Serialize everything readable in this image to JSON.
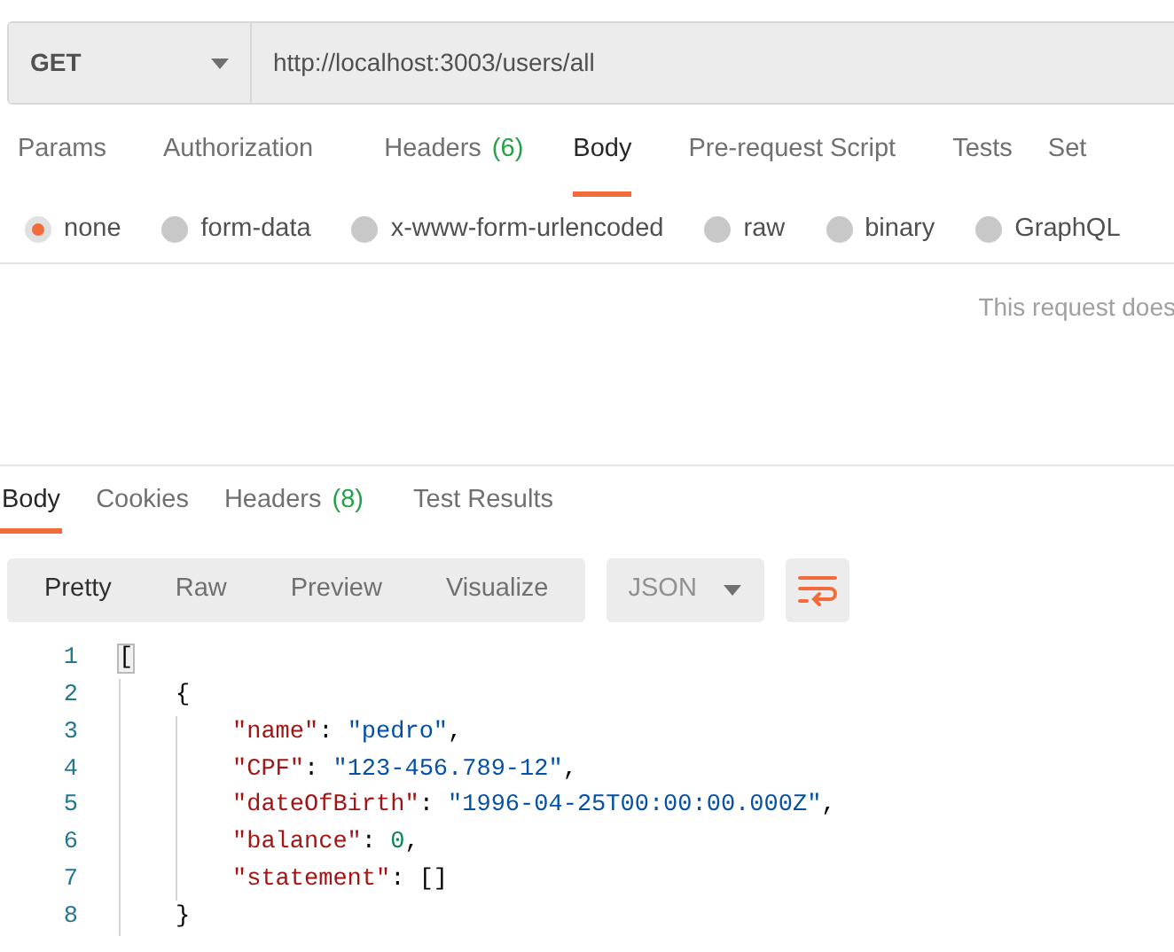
{
  "request": {
    "method": "GET",
    "url": "http://localhost:3003/users/all"
  },
  "request_tabs": [
    {
      "label": "Params",
      "selected": false
    },
    {
      "label": "Authorization",
      "selected": false
    },
    {
      "label": "Headers",
      "count": "(6)",
      "selected": false
    },
    {
      "label": "Body",
      "selected": true
    },
    {
      "label": "Pre-request Script",
      "selected": false
    },
    {
      "label": "Tests",
      "selected": false
    },
    {
      "label": "Set",
      "selected": false
    }
  ],
  "body_types": [
    {
      "label": "none",
      "selected": true
    },
    {
      "label": "form-data",
      "selected": false
    },
    {
      "label": "x-www-form-urlencoded",
      "selected": false
    },
    {
      "label": "raw",
      "selected": false
    },
    {
      "label": "binary",
      "selected": false
    },
    {
      "label": "GraphQL",
      "selected": false
    }
  ],
  "body_message": "This request does",
  "response_tabs": [
    {
      "label": "Body",
      "selected": true
    },
    {
      "label": "Cookies",
      "selected": false
    },
    {
      "label": "Headers",
      "count": "(8)",
      "selected": false
    },
    {
      "label": "Test Results",
      "selected": false
    }
  ],
  "view_modes": [
    {
      "label": "Pretty",
      "selected": true
    },
    {
      "label": "Raw",
      "selected": false
    },
    {
      "label": "Preview",
      "selected": false
    },
    {
      "label": "Visualize",
      "selected": false
    }
  ],
  "format": "JSON",
  "code_lines": [
    {
      "number": "1",
      "tokens": [
        {
          "kind": "bracket",
          "text": "["
        }
      ],
      "children": [
        {
          "number": "2",
          "tokens": [
            {
              "kind": "punct",
              "text": "{"
            }
          ],
          "children": [
            {
              "number": "3",
              "tokens": [
                {
                  "kind": "key",
                  "text": "\"name\""
                },
                {
                  "kind": "punct",
                  "text": ": "
                },
                {
                  "kind": "string",
                  "text": "\"pedro\""
                },
                {
                  "kind": "punct",
                  "text": ","
                }
              ]
            },
            {
              "number": "4",
              "tokens": [
                {
                  "kind": "key",
                  "text": "\"CPF\""
                },
                {
                  "kind": "punct",
                  "text": ": "
                },
                {
                  "kind": "string",
                  "text": "\"123-456.789-12\""
                },
                {
                  "kind": "punct",
                  "text": ","
                }
              ]
            },
            {
              "number": "5",
              "tokens": [
                {
                  "kind": "key",
                  "text": "\"dateOfBirth\""
                },
                {
                  "kind": "punct",
                  "text": ": "
                },
                {
                  "kind": "string",
                  "text": "\"1996-04-25T00:00:00.000Z\""
                },
                {
                  "kind": "punct",
                  "text": ","
                }
              ]
            },
            {
              "number": "6",
              "tokens": [
                {
                  "kind": "key",
                  "text": "\"balance\""
                },
                {
                  "kind": "punct",
                  "text": ": "
                },
                {
                  "kind": "number",
                  "text": "0"
                },
                {
                  "kind": "punct",
                  "text": ","
                }
              ]
            },
            {
              "number": "7",
              "tokens": [
                {
                  "kind": "key",
                  "text": "\"statement\""
                },
                {
                  "kind": "punct",
                  "text": ": []"
                }
              ]
            }
          ]
        },
        {
          "number": "8",
          "tokens": [
            {
              "kind": "punct",
              "text": "}"
            }
          ]
        }
      ]
    }
  ]
}
